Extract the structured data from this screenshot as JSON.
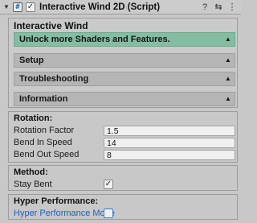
{
  "header": {
    "fold_icon": "chevron-down-icon",
    "script_icon": "#",
    "enabled_check": "✓",
    "title": "Interactive Wind 2D (Script)",
    "icons": {
      "help": "?",
      "preset": "⇆",
      "menu": "⋮"
    }
  },
  "main": {
    "title": "Interactive Wind",
    "bars": [
      {
        "label": "Unlock more Shaders and Features.",
        "arrow": "▲",
        "color": "#85bda3"
      },
      {
        "label": "Setup",
        "arrow": "▲"
      },
      {
        "label": "Troubleshooting",
        "arrow": "▲"
      },
      {
        "label": "Information",
        "arrow": "▲"
      }
    ]
  },
  "rotation": {
    "title": "Rotation:",
    "rows": [
      {
        "label": "Rotation Factor",
        "value": "1.5"
      },
      {
        "label": "Bend In Speed",
        "value": "14"
      },
      {
        "label": "Bend Out Speed",
        "value": "8"
      }
    ]
  },
  "method": {
    "title": "Method:",
    "stay_bent_label": "Stay Bent",
    "stay_bent_check": "✓"
  },
  "hyper": {
    "title": "Hyper Performance:",
    "mode_label": "Hyper Performance Mode",
    "mode_check": ""
  }
}
